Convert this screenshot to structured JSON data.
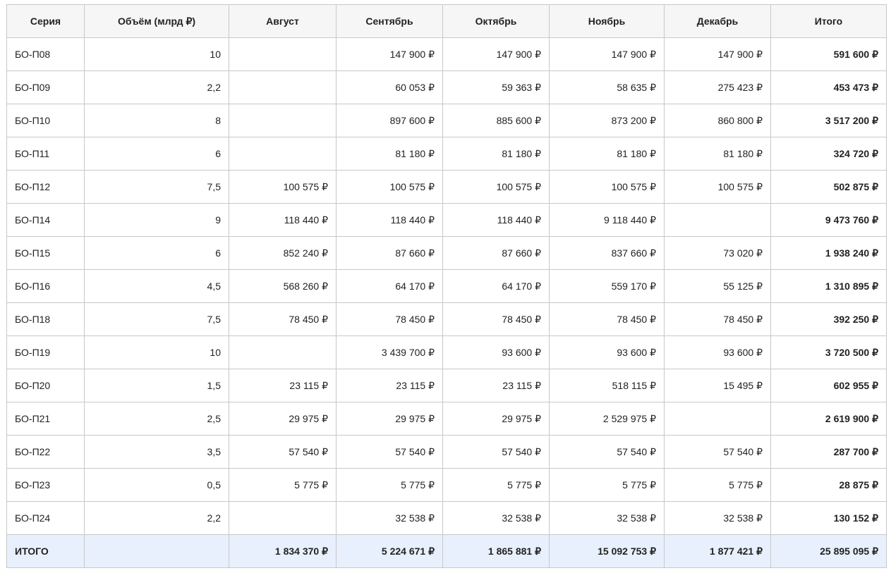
{
  "table": {
    "headers": [
      "Серия",
      "Объём (млрд ₽)",
      "Август",
      "Сентябрь",
      "Октябрь",
      "Ноябрь",
      "Декабрь",
      "Итого"
    ],
    "rows": [
      [
        "БО-П08",
        "10",
        "",
        "147 900 ₽",
        "147 900 ₽",
        "147 900 ₽",
        "147 900 ₽",
        "591 600 ₽"
      ],
      [
        "БО-П09",
        "2,2",
        "",
        "60 053 ₽",
        "59 363 ₽",
        "58 635 ₽",
        "275 423 ₽",
        "453 473 ₽"
      ],
      [
        "БО-П10",
        "8",
        "",
        "897 600 ₽",
        "885 600 ₽",
        "873 200 ₽",
        "860 800 ₽",
        "3 517 200 ₽"
      ],
      [
        "БО-П11",
        "6",
        "",
        "81 180 ₽",
        "81 180 ₽",
        "81 180 ₽",
        "81 180 ₽",
        "324 720 ₽"
      ],
      [
        "БО-П12",
        "7,5",
        "100 575 ₽",
        "100 575 ₽",
        "100 575 ₽",
        "100 575 ₽",
        "100 575 ₽",
        "502 875 ₽"
      ],
      [
        "БО-П14",
        "9",
        "118 440 ₽",
        "118 440 ₽",
        "118 440 ₽",
        "9 118 440 ₽",
        "",
        "9 473 760 ₽"
      ],
      [
        "БО-П15",
        "6",
        "852 240 ₽",
        "87 660 ₽",
        "87 660 ₽",
        "837 660 ₽",
        "73 020 ₽",
        "1 938 240 ₽"
      ],
      [
        "БО-П16",
        "4,5",
        "568 260 ₽",
        "64 170 ₽",
        "64 170 ₽",
        "559 170 ₽",
        "55 125 ₽",
        "1 310 895 ₽"
      ],
      [
        "БО-П18",
        "7,5",
        "78 450 ₽",
        "78 450 ₽",
        "78 450 ₽",
        "78 450 ₽",
        "78 450 ₽",
        "392 250 ₽"
      ],
      [
        "БО-П19",
        "10",
        "",
        "3 439 700 ₽",
        "93 600 ₽",
        "93 600 ₽",
        "93 600 ₽",
        "3 720 500 ₽"
      ],
      [
        "БО-П20",
        "1,5",
        "23 115 ₽",
        "23 115 ₽",
        "23 115 ₽",
        "518 115 ₽",
        "15 495 ₽",
        "602 955 ₽"
      ],
      [
        "БО-П21",
        "2,5",
        "29 975 ₽",
        "29 975 ₽",
        "29 975 ₽",
        "2 529 975 ₽",
        "",
        "2 619 900 ₽"
      ],
      [
        "БО-П22",
        "3,5",
        "57 540 ₽",
        "57 540 ₽",
        "57 540 ₽",
        "57 540 ₽",
        "57 540 ₽",
        "287 700 ₽"
      ],
      [
        "БО-П23",
        "0,5",
        "5 775 ₽",
        "5 775 ₽",
        "5 775 ₽",
        "5 775 ₽",
        "5 775 ₽",
        "28 875 ₽"
      ],
      [
        "БО-П24",
        "2,2",
        "",
        "32 538 ₽",
        "32 538 ₽",
        "32 538 ₽",
        "32 538 ₽",
        "130 152 ₽"
      ]
    ],
    "totals": [
      "ИТОГО",
      "",
      "1 834 370 ₽",
      "5 224 671 ₽",
      "1 865 881 ₽",
      "15 092 753 ₽",
      "1 877 421 ₽",
      "25 895 095 ₽"
    ]
  }
}
